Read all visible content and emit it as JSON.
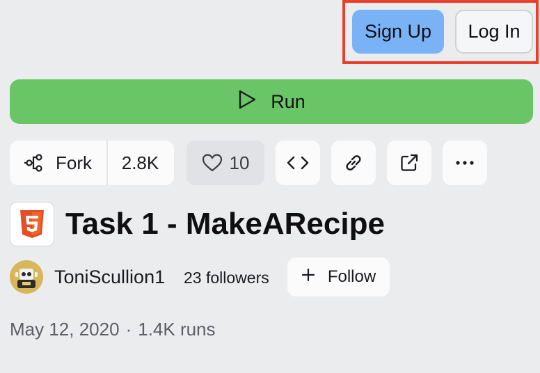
{
  "auth": {
    "signup_label": "Sign Up",
    "login_label": "Log In",
    "highlight_color": "#e8402a",
    "signup_color": "#7ab2f6"
  },
  "run": {
    "label": "Run",
    "icon": "play-icon",
    "color": "#6ac566"
  },
  "actions": {
    "fork_label": "Fork",
    "fork_icon": "fork-icon",
    "fork_count": "2.8K",
    "like_icon": "heart-icon",
    "like_count": "10",
    "embed_icon": "code-brackets-icon",
    "link_icon": "link-icon",
    "open_icon": "external-link-icon",
    "more_icon": "more-horizontal-icon"
  },
  "repl": {
    "language_icon": "html5-logo-icon",
    "title": "Task 1 - MakeARecipe"
  },
  "author": {
    "username": "ToniScullion1",
    "followers": "23 followers",
    "follow_label": "Follow",
    "follow_icon": "plus-icon"
  },
  "meta": {
    "date": "May 12, 2020",
    "separator": "·",
    "runs": "1.4K runs"
  }
}
